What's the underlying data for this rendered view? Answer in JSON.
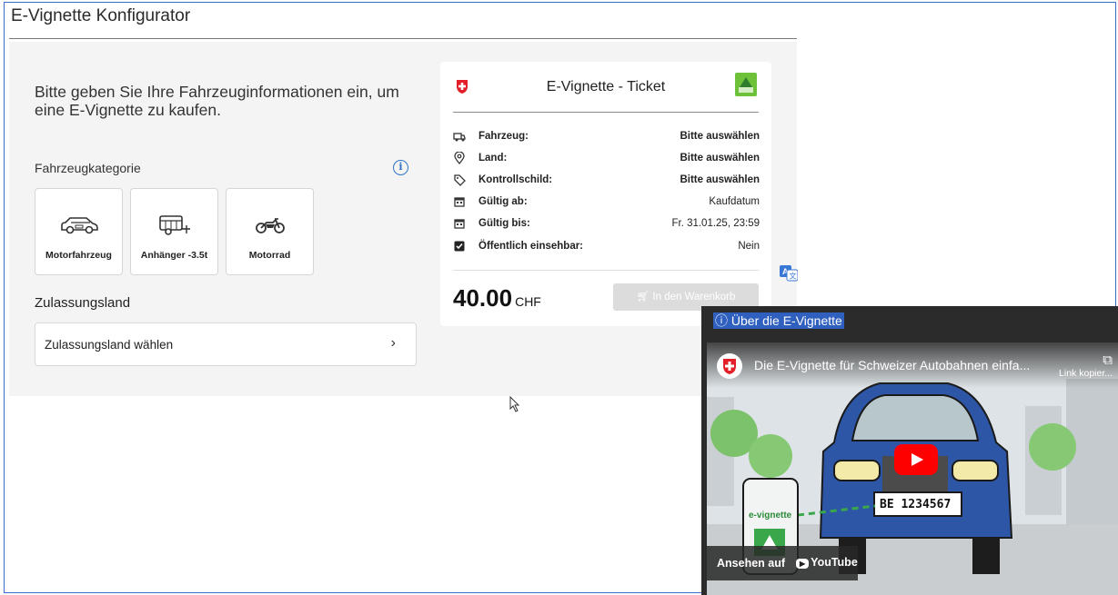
{
  "app": {
    "title": "E-Vignette Konfigurator"
  },
  "form": {
    "intro": "Bitte geben Sie Ihre Fahrzeuginformationen ein, um eine E-Vignette zu kaufen.",
    "category_label": "Fahrzeugkategorie",
    "categories": [
      {
        "label": "Motorfahrzeug",
        "icon": "car-icon"
      },
      {
        "label": "Anhänger -3.5t",
        "icon": "trailer-icon"
      },
      {
        "label": "Motorrad",
        "icon": "motorcycle-icon"
      }
    ],
    "registration_heading": "Zulassungsland",
    "registration_select": "Zulassungsland wählen"
  },
  "ticket": {
    "title": "E-Vignette - Ticket",
    "rows": [
      {
        "label": "Fahrzeug:",
        "value": "Bitte auswählen",
        "icon": "vehicle-icon"
      },
      {
        "label": "Land:",
        "value": "Bitte auswählen",
        "icon": "location-pin-icon"
      },
      {
        "label": "Kontrollschild:",
        "value": "Bitte auswählen",
        "icon": "tag-icon"
      },
      {
        "label": "Gültig ab:",
        "value": "Kaufdatum",
        "icon": "calendar-icon"
      },
      {
        "label": "Gültig bis:",
        "value": "Fr. 31.01.25, 23:59",
        "icon": "calendar-icon"
      },
      {
        "label": "Öffentlich einsehbar:",
        "value": "Nein",
        "icon": "checkbox-icon"
      }
    ],
    "price": "40.00",
    "currency": "CHF",
    "cart_button": "In den Warenkorb"
  },
  "video": {
    "header": "Über die E-Vignette",
    "title": "Die E-Vignette für Schweizer Autobahnen einfa...",
    "copy_link": "Link kopier...",
    "plate": "BE 1234567",
    "app_label": "e-vignette",
    "watch_on": "Ansehen auf",
    "youtube": "YouTube"
  },
  "colors": {
    "accent": "#2f73c8",
    "swiss_red": "#e3202a",
    "vignette_green": "#6ec23a",
    "panel_bg": "#f4f4f4"
  }
}
